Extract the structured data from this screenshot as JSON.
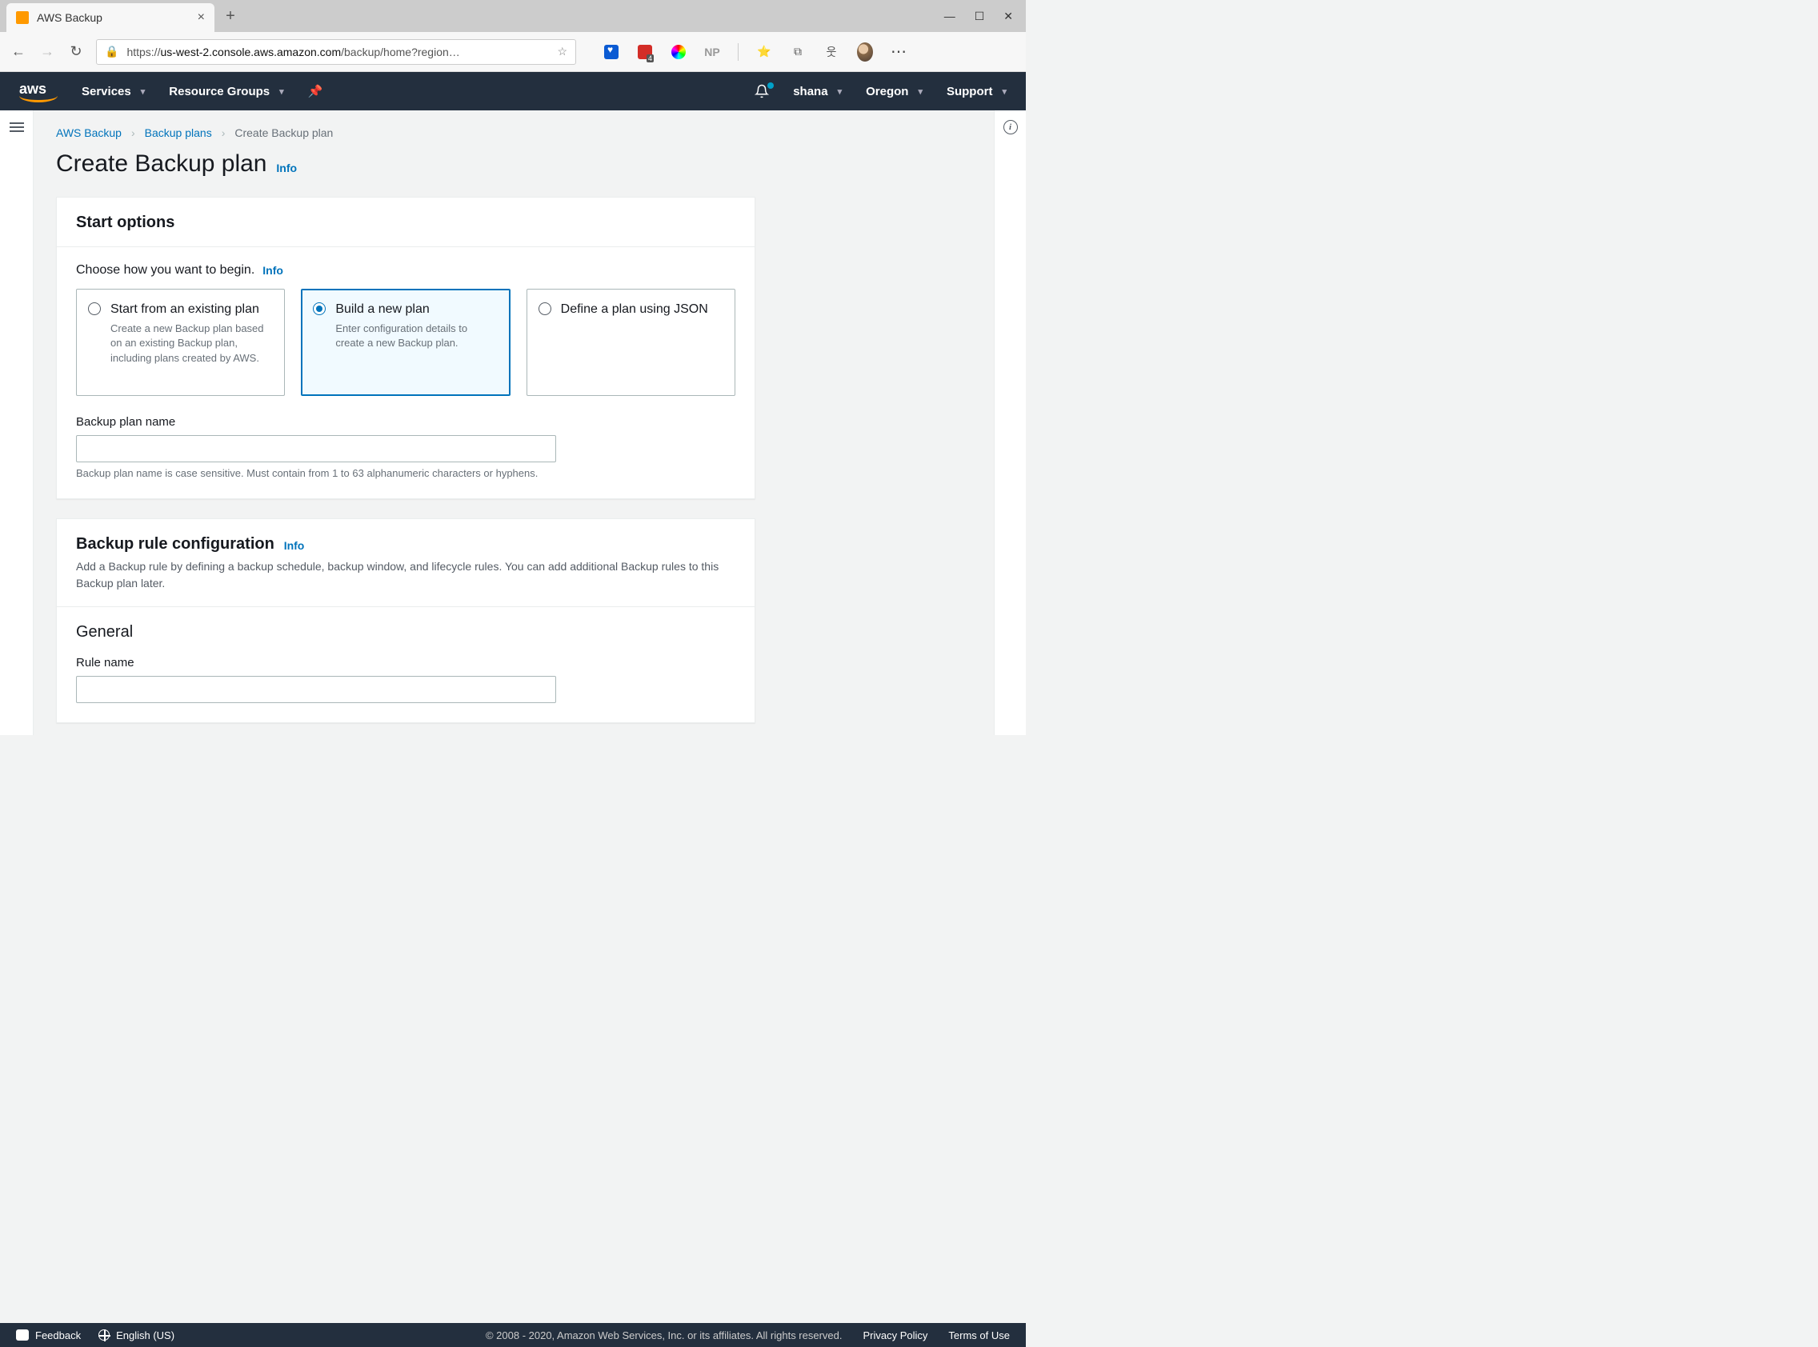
{
  "browser": {
    "tab_title": "AWS Backup",
    "url_prefix": "https://",
    "url_domain": "us-west-2.console.aws.amazon.com",
    "url_path": "/backup/home?region…",
    "np_label": "NP"
  },
  "nav": {
    "services": "Services",
    "resource_groups": "Resource Groups",
    "user": "shana",
    "region": "Oregon",
    "support": "Support"
  },
  "breadcrumb": {
    "root": "AWS Backup",
    "plans": "Backup plans",
    "current": "Create Backup plan"
  },
  "page": {
    "title": "Create Backup plan",
    "info": "Info"
  },
  "start_options": {
    "header": "Start options",
    "choose_label": "Choose how you want to begin.",
    "info": "Info",
    "tiles": [
      {
        "title": "Start from an existing plan",
        "desc": "Create a new Backup plan based on an existing Backup plan, including plans created by AWS."
      },
      {
        "title": "Build a new plan",
        "desc": "Enter configuration details to create a new Backup plan."
      },
      {
        "title": "Define a plan using JSON",
        "desc": ""
      }
    ],
    "selected_index": 1,
    "name_label": "Backup plan name",
    "name_value": "",
    "name_hint": "Backup plan name is case sensitive. Must contain from 1 to 63 alphanumeric characters or hyphens."
  },
  "rule_config": {
    "header": "Backup rule configuration",
    "info": "Info",
    "desc": "Add a Backup rule by defining a backup schedule, backup window, and lifecycle rules. You can add additional Backup rules to this Backup plan later.",
    "general": "General",
    "rule_name_label": "Rule name",
    "rule_name_value": ""
  },
  "footer": {
    "feedback": "Feedback",
    "language": "English (US)",
    "copyright": "© 2008 - 2020, Amazon Web Services, Inc. or its affiliates. All rights reserved.",
    "privacy": "Privacy Policy",
    "terms": "Terms of Use"
  }
}
